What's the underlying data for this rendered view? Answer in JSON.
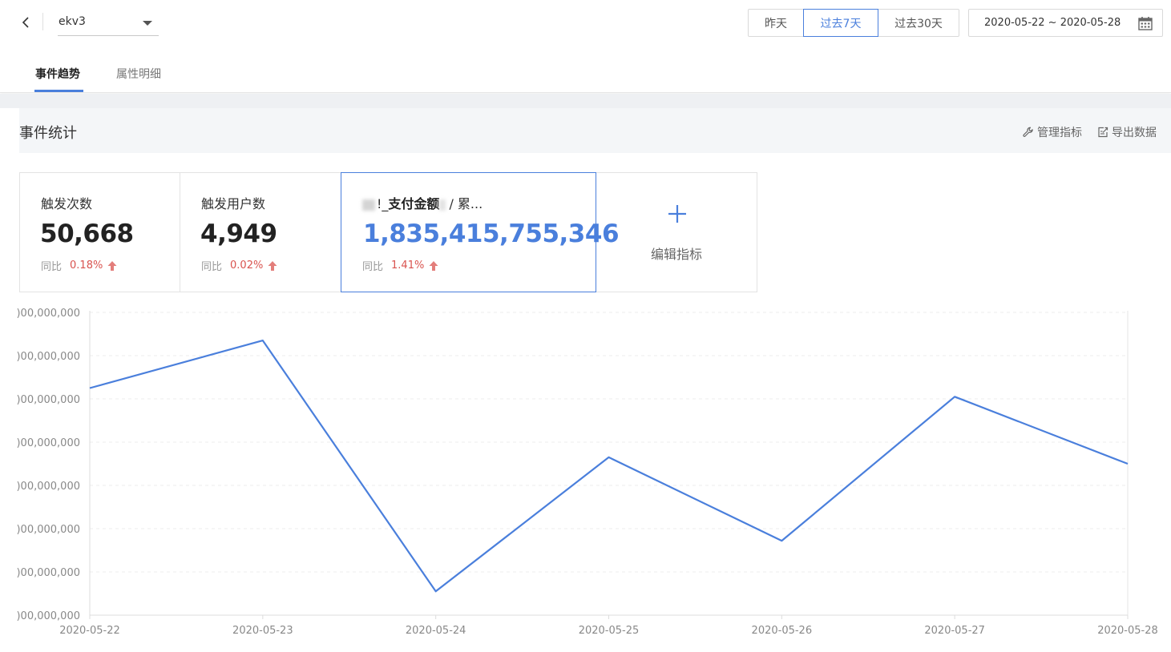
{
  "header": {
    "event_select": {
      "value": "ekv3"
    },
    "ranges": [
      "昨天",
      "过去7天",
      "过去30天"
    ],
    "active_range": 1,
    "date_range": "2020-05-22 ~ 2020-05-28"
  },
  "tabs": [
    {
      "label": "事件趋势",
      "active": true
    },
    {
      "label": "属性明细",
      "active": false
    }
  ],
  "section": {
    "title": "事件统计",
    "manage_label": "管理指标",
    "export_label": "导出数据"
  },
  "metrics": [
    {
      "label": "触发次数",
      "value": "50,668",
      "cmp_label": "同比",
      "cmp_value": "0.18%"
    },
    {
      "label": "触发用户数",
      "value": "4,949",
      "cmp_label": "同比",
      "cmp_value": "0.02%"
    },
    {
      "label_prefix": "!_",
      "label_strong": "支付金额",
      "label_suffix": "/ 累...",
      "value": "1,835,415,755,346",
      "cmp_label": "同比",
      "cmp_value": "1.41%"
    }
  ],
  "add_metric": {
    "label": "编辑指标"
  },
  "colors": {
    "accent": "#4a7fdc",
    "up": "#d9534f"
  },
  "chart_data": {
    "type": "line",
    "x": [
      "2020-05-22",
      "2020-05-23",
      "2020-05-24",
      "2020-05-25",
      "2020-05-26",
      "2020-05-27",
      "2020-05-28"
    ],
    "y_ticks": [
      ")00,000,000",
      ")00,000,000",
      ")00,000,000",
      ")00,000,000",
      ")00,000,000",
      ")00,000,000",
      ")00,000,000",
      ")00,000,000"
    ],
    "ylim": [
      0,
      7
    ],
    "series": [
      {
        "values": [
          5.25,
          6.35,
          0.55,
          3.65,
          1.72,
          5.05,
          3.5
        ],
        "color": "#4a7fdc"
      }
    ],
    "grid": true
  }
}
